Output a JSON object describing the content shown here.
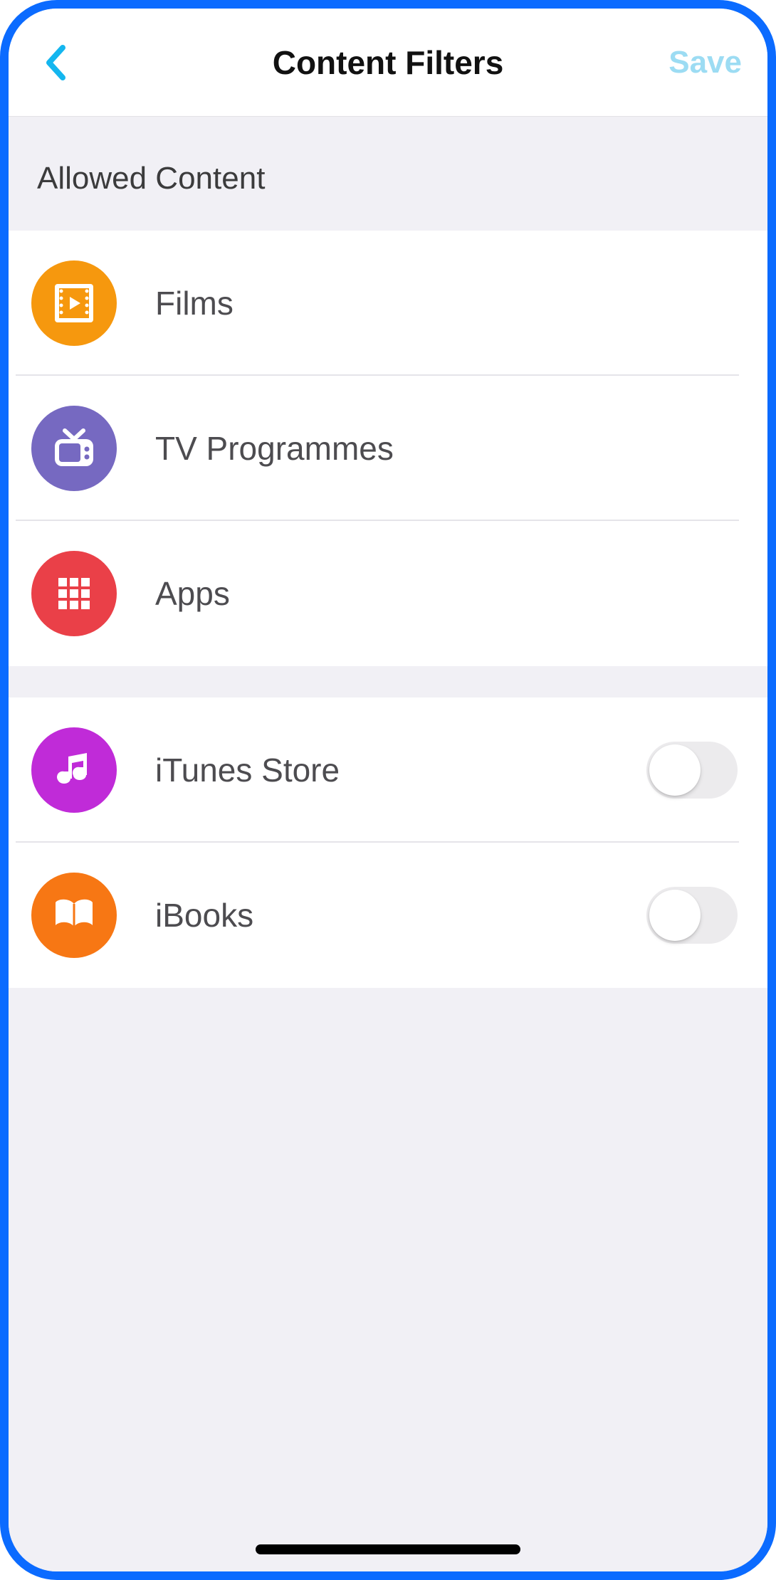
{
  "nav": {
    "title": "Content Filters",
    "save_label": "Save"
  },
  "section": {
    "header": "Allowed Content"
  },
  "items": {
    "films": {
      "label": "Films",
      "icon": "film-icon",
      "color": "#F6980E"
    },
    "tv": {
      "label": "TV Programmes",
      "icon": "tv-icon",
      "color": "#7669C1"
    },
    "apps": {
      "label": "Apps",
      "icon": "apps-grid-icon",
      "color": "#EA4048"
    },
    "itunes": {
      "label": "iTunes Store",
      "icon": "music-note-icon",
      "color": "#C02BD8",
      "toggle": false
    },
    "ibooks": {
      "label": "iBooks",
      "icon": "book-icon",
      "color": "#F77714",
      "toggle": false
    }
  }
}
